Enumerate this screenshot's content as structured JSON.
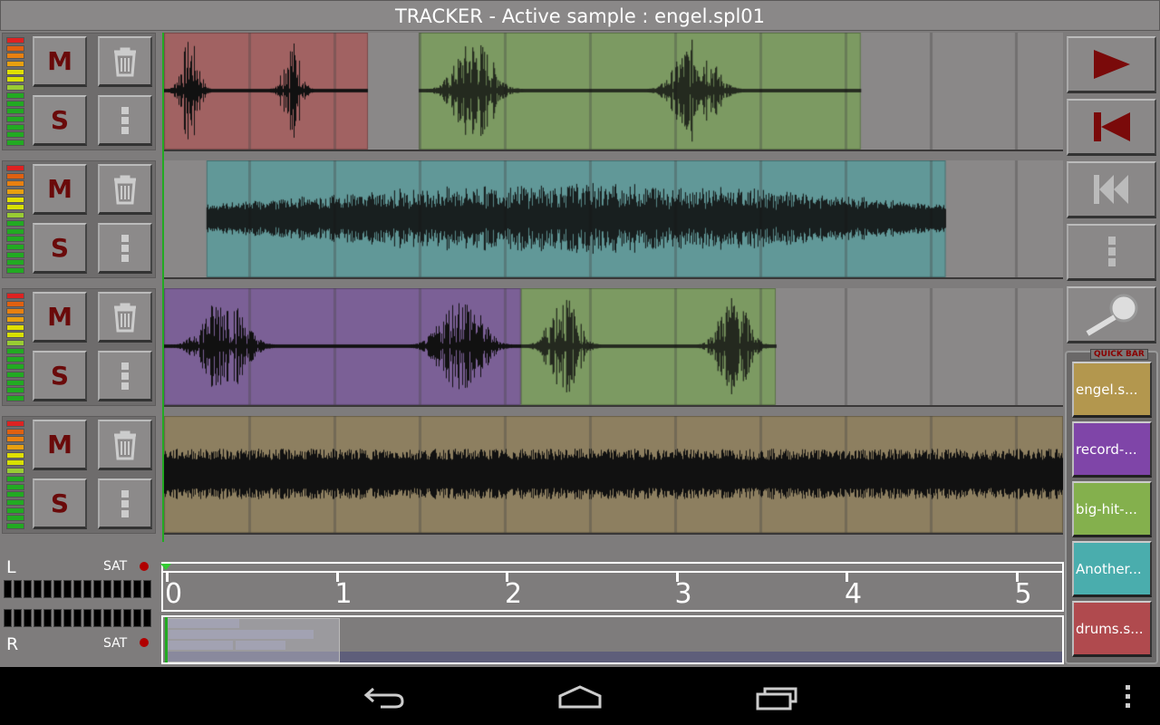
{
  "title": "TRACKER - Active sample : engel.spl01",
  "tracks": [
    {
      "mute": "M",
      "solo": "S",
      "clips": [
        {
          "start": 0,
          "end": 1.2,
          "color": "#a16262"
        },
        {
          "start": 1.5,
          "end": 4.1,
          "color": "#7c9a62"
        }
      ]
    },
    {
      "mute": "M",
      "solo": "S",
      "clips": [
        {
          "start": 0.25,
          "end": 4.6,
          "color": "#619898"
        }
      ]
    },
    {
      "mute": "M",
      "solo": "S",
      "clips": [
        {
          "start": 0,
          "end": 2.1,
          "color": "#7b6096"
        },
        {
          "start": 2.1,
          "end": 3.6,
          "color": "#7c9a62"
        }
      ]
    },
    {
      "mute": "M",
      "solo": "S",
      "clips": [
        {
          "start": 0,
          "end": 5.3,
          "color": "#8d7f60"
        }
      ]
    }
  ],
  "transport": {
    "buttons": [
      "play-icon",
      "skip-to-start-icon",
      "rewind-icon",
      "more-icon",
      "zoom-icon"
    ],
    "accent": "#7a0a0a"
  },
  "quick_bar": {
    "title": "QUICK BAR",
    "items": [
      {
        "label": "engel.s...",
        "color": "#b3974e"
      },
      {
        "label": "record-...",
        "color": "#7f45a8"
      },
      {
        "label": "big-hit-...",
        "color": "#84b04d"
      },
      {
        "label": "Another...",
        "color": "#4aadad"
      },
      {
        "label": "drums.s...",
        "color": "#b04a4e"
      }
    ]
  },
  "master": {
    "left": "L",
    "right": "R",
    "sat": "SAT"
  },
  "timeline": {
    "ticks": [
      "0",
      "1",
      "2",
      "3",
      "4",
      "5"
    ]
  }
}
